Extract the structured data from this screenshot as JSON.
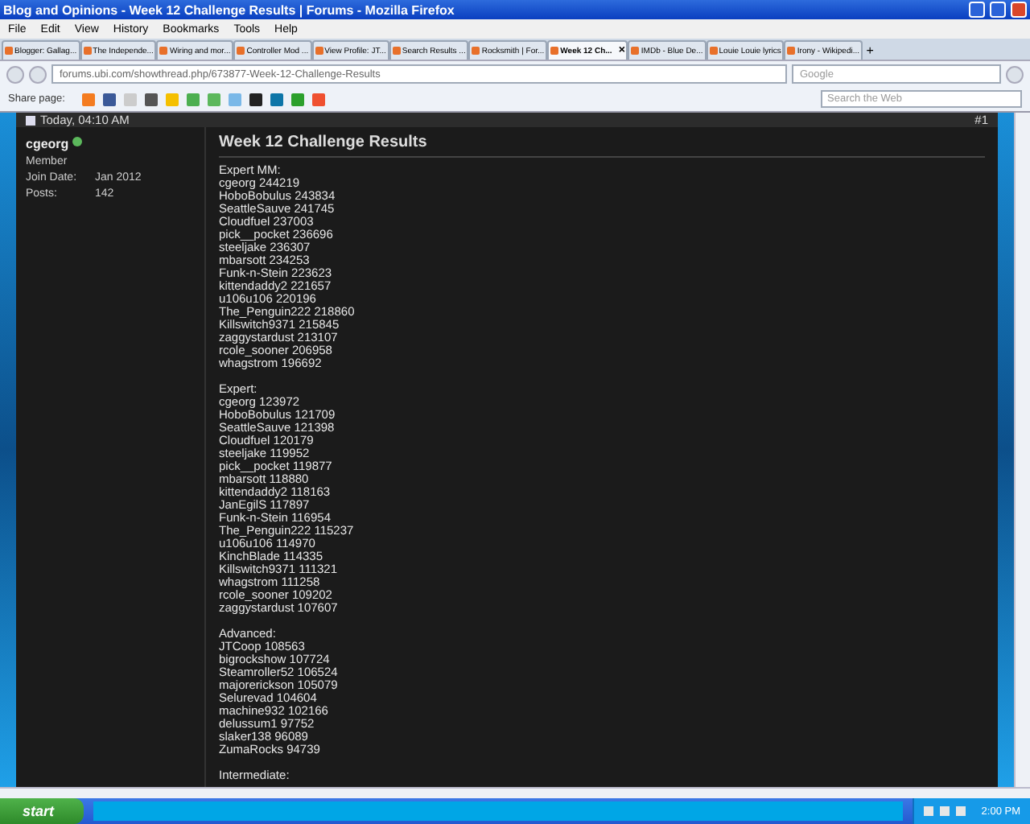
{
  "window": {
    "title": "Blog and Opinions - Week 12 Challenge Results | Forums - Mozilla Firefox"
  },
  "menu": [
    "File",
    "Edit",
    "View",
    "History",
    "Bookmarks",
    "Tools",
    "Help"
  ],
  "tabs": [
    {
      "label": "Blogger: Gallag...",
      "selected": false
    },
    {
      "label": "The Independe...",
      "selected": false
    },
    {
      "label": "Wiring and mor...",
      "selected": false
    },
    {
      "label": "Controller Mod ...",
      "selected": false
    },
    {
      "label": "View Profile: JT...",
      "selected": false
    },
    {
      "label": "Search Results ...",
      "selected": false
    },
    {
      "label": "Rocksmith | For...",
      "selected": false
    },
    {
      "label": "Week 12 Ch...",
      "selected": true,
      "close": "×"
    },
    {
      "label": "IMDb - Blue De...",
      "selected": false
    },
    {
      "label": "Louie Louie lyrics",
      "selected": false
    },
    {
      "label": "Irony - Wikipedi...",
      "selected": false
    }
  ],
  "new_tab_button": "+",
  "address": {
    "url": "forums.ubi.com/showthread.php/673877-Week-12-Challenge-Results",
    "search_placeholder": "Google"
  },
  "share_bar": {
    "label": "Share page:",
    "search_placeholder": "Search the Web"
  },
  "post": {
    "date": "Today, 04:10 AM",
    "number": "#1",
    "user": {
      "name": "cgeorg",
      "online": true,
      "role": "Member",
      "fields": [
        {
          "label": "Join Date:",
          "value": "Jan 2012"
        },
        {
          "label": "Posts:",
          "value": "142"
        }
      ]
    },
    "title": "Week 12 Challenge Results",
    "groups": [
      {
        "heading": "Expert MM:",
        "entries": [
          "cgeorg 244219",
          "HoboBobulus 243834",
          "SeattleSauve 241745",
          "Cloudfuel 237003",
          "pick__pocket 236696",
          "steeljake 236307",
          "mbarsott 234253",
          "Funk-n-Stein 223623",
          "kittendaddy2 221657",
          "u106u106 220196",
          "The_Penguin222 218860",
          "Killswitch9371 215845",
          "zaggystardust 213107",
          "rcole_sooner 206958",
          "whagstrom 196692"
        ]
      },
      {
        "heading": "Expert:",
        "entries": [
          "cgeorg 123972",
          "HoboBobulus 121709",
          "SeattleSauve 121398",
          "Cloudfuel 120179",
          "steeljake 119952",
          "pick__pocket 119877",
          "mbarsott 118880",
          "kittendaddy2 118163",
          "JanEgilS 117897",
          "Funk-n-Stein 116954",
          "The_Penguin222 115237",
          "u106u106 114970",
          "KinchBlade 114335",
          "Killswitch9371 111321",
          "whagstrom 111258",
          "rcole_sooner 109202",
          "zaggystardust 107607"
        ]
      },
      {
        "heading": "Advanced:",
        "entries": [
          "JTCoop 108563",
          "bigrockshow 107724",
          "Steamroller52 106524",
          "majorerickson 105079",
          "Selurevad 104604",
          "machine932 102166",
          "delussum1 97752",
          "slaker138 96089",
          "ZumaRocks 94739"
        ]
      },
      {
        "heading": "Intermediate:"
      }
    ]
  },
  "taskbar": {
    "start": "start",
    "clock": "2:00 PM"
  }
}
